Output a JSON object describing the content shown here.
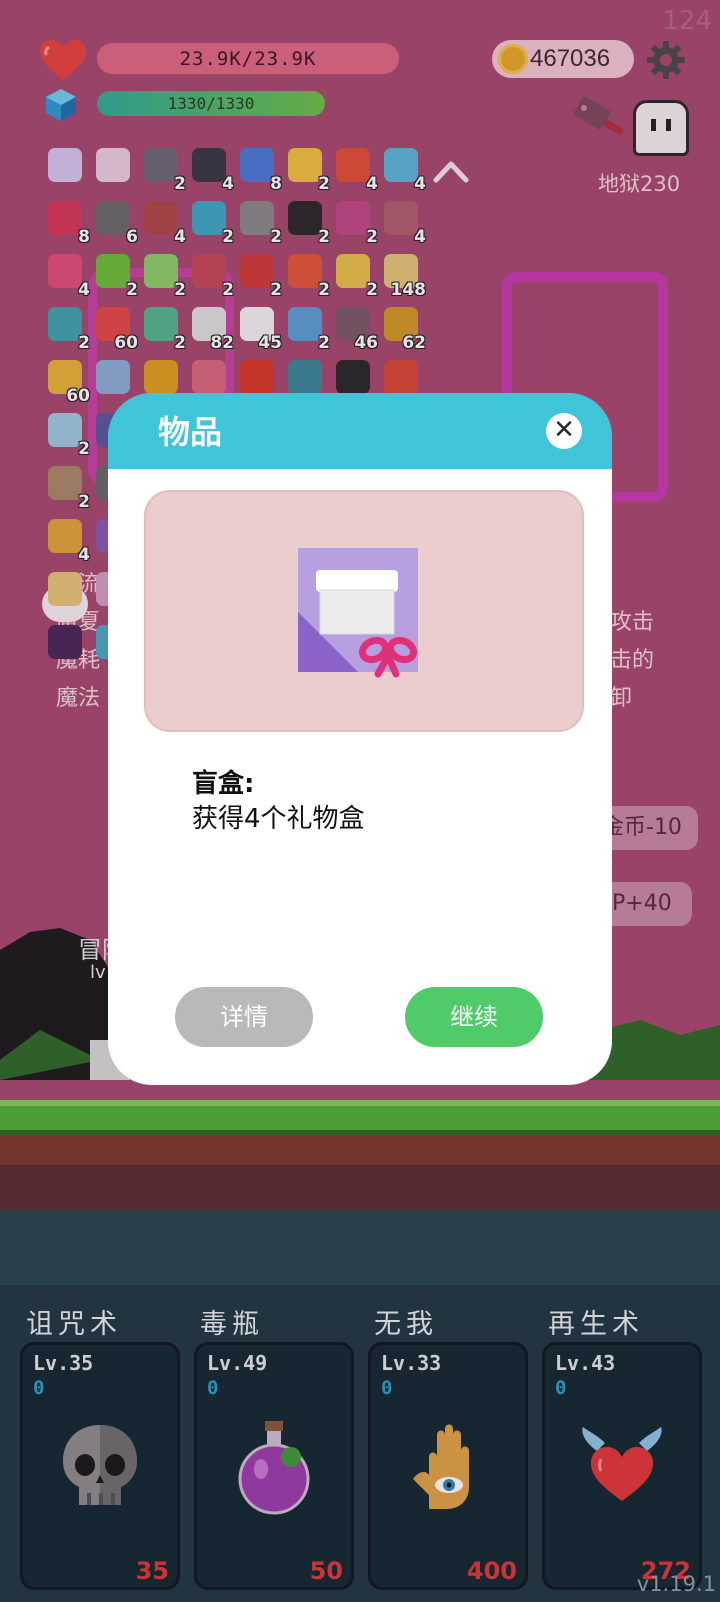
{
  "hud": {
    "fps": "124",
    "hp_text": "23.9K/23.9K",
    "mp_text": "1330/1330",
    "coins": "467036",
    "stage": "地狱230"
  },
  "items": [
    {
      "icon": "gift-box-icon",
      "count": ""
    },
    {
      "icon": "gift-box-icon",
      "count": ""
    },
    {
      "icon": "gift-box-icon",
      "count": "2"
    },
    {
      "icon": "cauldron-icon",
      "count": "4"
    },
    {
      "icon": "snowflake-icon",
      "count": "8"
    },
    {
      "icon": "sun-icon",
      "count": "2"
    },
    {
      "icon": "flame-ring-icon",
      "count": "4"
    },
    {
      "icon": "crosshair-icon",
      "count": "4"
    },
    {
      "icon": "ruby-icon",
      "count": "8"
    },
    {
      "icon": "claw-icon",
      "count": "6"
    },
    {
      "icon": "crossed-swords-icon",
      "count": "4"
    },
    {
      "icon": "cycle-icon",
      "count": "2"
    },
    {
      "icon": "compass-icon",
      "count": "2"
    },
    {
      "icon": "bomb-icon",
      "count": "2"
    },
    {
      "icon": "hook-icon",
      "count": "2"
    },
    {
      "icon": "bowl-icon",
      "count": "4"
    },
    {
      "icon": "fire-drop-icon",
      "count": "4"
    },
    {
      "icon": "lime-icon",
      "count": "2"
    },
    {
      "icon": "card-icon",
      "count": "2"
    },
    {
      "icon": "shield-icon",
      "count": "2"
    },
    {
      "icon": "magnet-icon",
      "count": "2"
    },
    {
      "icon": "thermometer-icon",
      "count": "2"
    },
    {
      "icon": "quill-icon",
      "count": "2"
    },
    {
      "icon": "map-icon",
      "count": "148"
    },
    {
      "icon": "vortex-icon",
      "count": "2"
    },
    {
      "icon": "watermelon-icon",
      "count": "60"
    },
    {
      "icon": "statue-icon",
      "count": "2"
    },
    {
      "icon": "ghost-icon",
      "count": "82"
    },
    {
      "icon": "dice-icon",
      "count": "45"
    },
    {
      "icon": "star-card-icon",
      "count": "2"
    },
    {
      "icon": "tombstone-icon",
      "count": "46"
    },
    {
      "icon": "book-icon",
      "count": "62"
    },
    {
      "icon": "coin-stack-icon",
      "count": "60"
    },
    {
      "icon": "coat-icon",
      "count": ""
    },
    {
      "icon": "melon-icon",
      "count": ""
    },
    {
      "icon": "flower-icon",
      "count": ""
    },
    {
      "icon": "apple-icon",
      "count": ""
    },
    {
      "icon": "disc-icon",
      "count": ""
    },
    {
      "icon": "camera-icon",
      "count": ""
    },
    {
      "icon": "boot-icon",
      "count": ""
    },
    {
      "icon": "ice-block-icon",
      "count": "2"
    },
    {
      "icon": "hat-icon",
      "count": ""
    },
    {
      "icon": "suitcase-icon",
      "count": "2"
    },
    {
      "icon": "gears-icon",
      "count": ""
    },
    {
      "icon": "scroll-icon",
      "count": "4"
    },
    {
      "icon": "potion-icon",
      "count": ""
    },
    {
      "icon": "treasure-map-icon",
      "count": ""
    },
    {
      "icon": "candy-icon",
      "count": ""
    },
    {
      "icon": "demon-icon",
      "count": ""
    },
    {
      "icon": "prism-icon",
      "count": ""
    }
  ],
  "background": {
    "left_texts": [
      "诅流",
      "魔夏",
      "魔耗",
      "魔法"
    ],
    "right_texts": [
      "攻击",
      "击的",
      "卸"
    ],
    "pill_1": "金币-10",
    "pill_2": "P+40",
    "hero_name": "冒险",
    "hero_lv": "lv"
  },
  "modal": {
    "title": "物品",
    "close": "✕",
    "item_name": "盲盒:",
    "item_desc": "获得4个礼物盒",
    "details_label": "详情",
    "continue_label": "继续"
  },
  "skills": [
    {
      "name": "诅咒术",
      "level": "Lv.35",
      "charge": "0",
      "cost": "35",
      "icon": "skull-icon"
    },
    {
      "name": "毒瓶",
      "level": "Lv.49",
      "charge": "0",
      "cost": "50",
      "icon": "poison-flask-icon"
    },
    {
      "name": "无我",
      "level": "Lv.33",
      "charge": "0",
      "cost": "400",
      "icon": "eye-hand-icon"
    },
    {
      "name": "再生术",
      "level": "Lv.43",
      "charge": "0",
      "cost": "272",
      "icon": "winged-heart-icon"
    }
  ],
  "version": "v1.19.1",
  "colors": {
    "background": "#a84b72",
    "modal_header": "#40c4d8",
    "continue_button": "#4fcb6a",
    "details_button": "#b9b9b9",
    "skill_cost": "#e03a3a"
  }
}
